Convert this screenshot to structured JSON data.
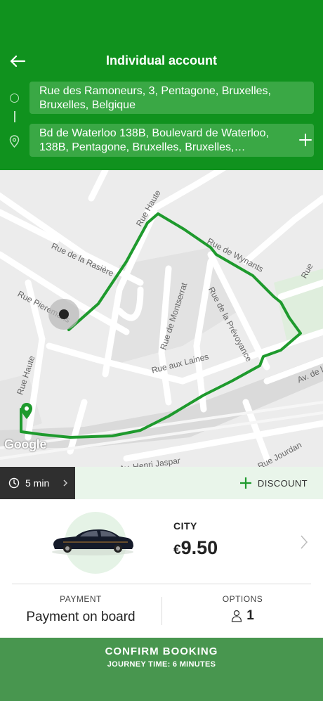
{
  "header": {
    "title": "Individual account",
    "from_address": "Rue des Ramoneurs, 3, Pentagone, Bruxelles, Bruxelles, Belgique",
    "to_address": "Bd de Waterloo 138B, Boulevard de Waterloo, 138B, Pentagone, Bruxelles, Bruxelles, Belgique"
  },
  "map": {
    "streets": [
      "Rue Haute",
      "Rue de la Rasière",
      "Rue Pieremans",
      "Rue de Wynants",
      "Rue de Montserrat",
      "Rue de la Prévoyance",
      "Rue aux Laines",
      "Rue Haute",
      "Av. de la",
      "Rue Jourdan",
      "Av. Henri Jaspar",
      "Rue"
    ],
    "logo": "Google",
    "route_color": "#1e9a2d"
  },
  "trip": {
    "duration": "5 min",
    "discount_label": "DISCOUNT"
  },
  "vehicle": {
    "type": "CITY",
    "currency": "€",
    "price": "9.50"
  },
  "payment": {
    "label": "PAYMENT",
    "value": "Payment on board"
  },
  "options": {
    "label": "OPTIONS",
    "passengers": "1"
  },
  "confirm": {
    "title": "CONFIRM BOOKING",
    "subtitle": "JOURNEY TIME: 6 MINUTES"
  },
  "colors": {
    "header": "#10921e",
    "address_box": "#3aa845",
    "confirm": "#48964f",
    "time_chip": "#2f2f2f"
  }
}
